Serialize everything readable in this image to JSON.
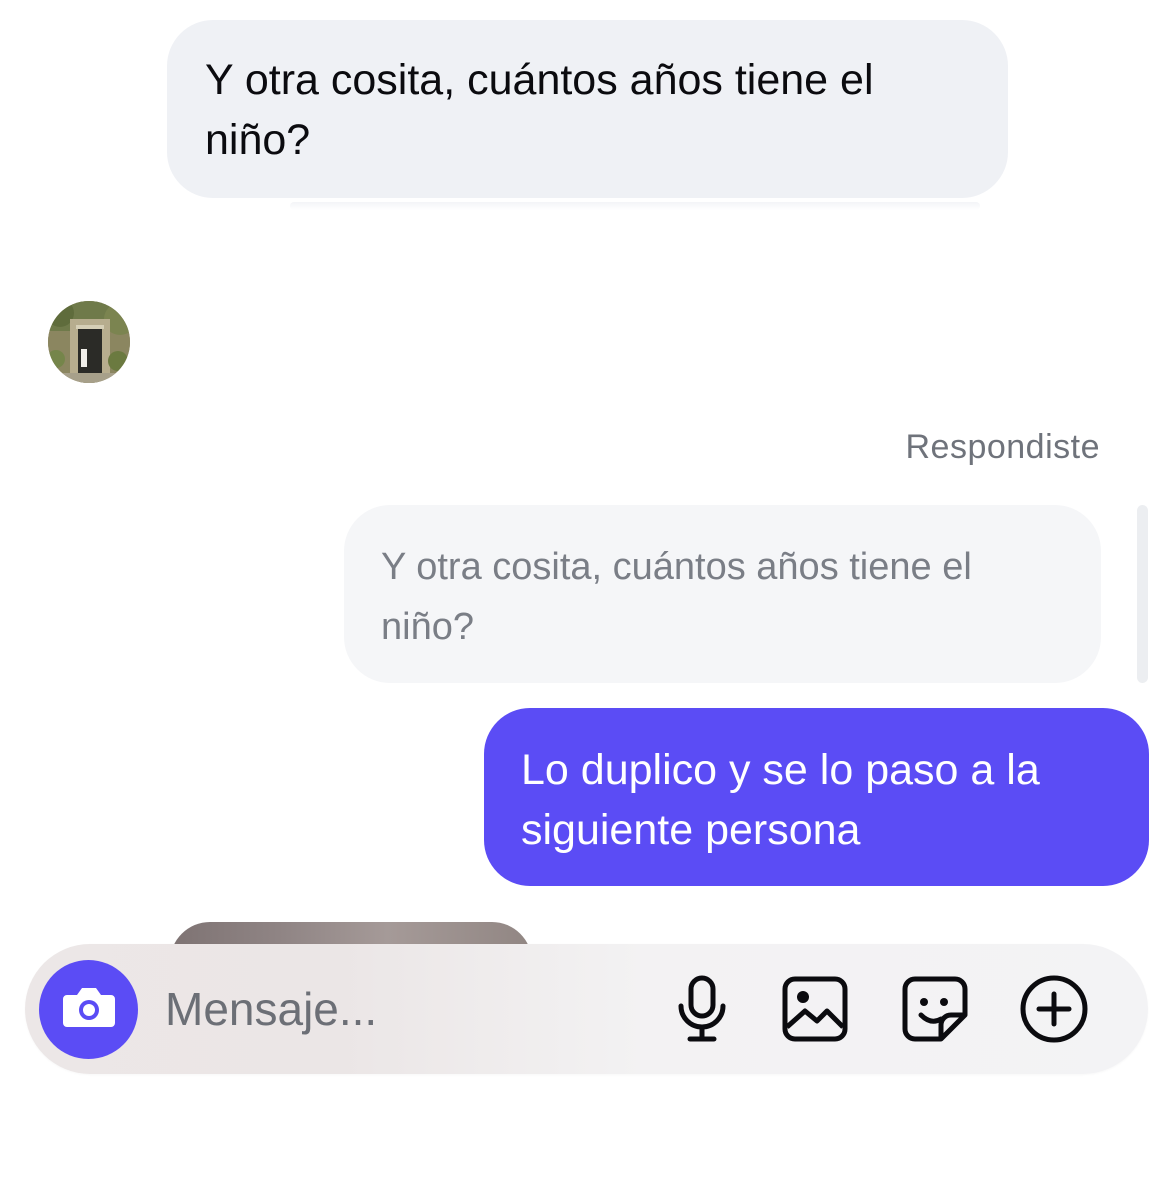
{
  "conversation": {
    "incoming_message": "Y otra cosita, cuántos años tiene el niño?",
    "reply_label": "Respondiste",
    "quoted_message": "Y otra cosita, cuántos años tiene el niño?",
    "outgoing_message": "Lo duplico y se lo paso a la siguiente persona"
  },
  "composer": {
    "placeholder": "Mensaje...",
    "icons": [
      "camera-icon",
      "microphone-icon",
      "gallery-icon",
      "sticker-icon",
      "add-icon"
    ]
  },
  "colors": {
    "accent": "#5b4cf5",
    "incoming_bubble": "#eff1f5",
    "quoted_bubble": "#f5f6f8",
    "secondary_text": "#6f737b"
  }
}
